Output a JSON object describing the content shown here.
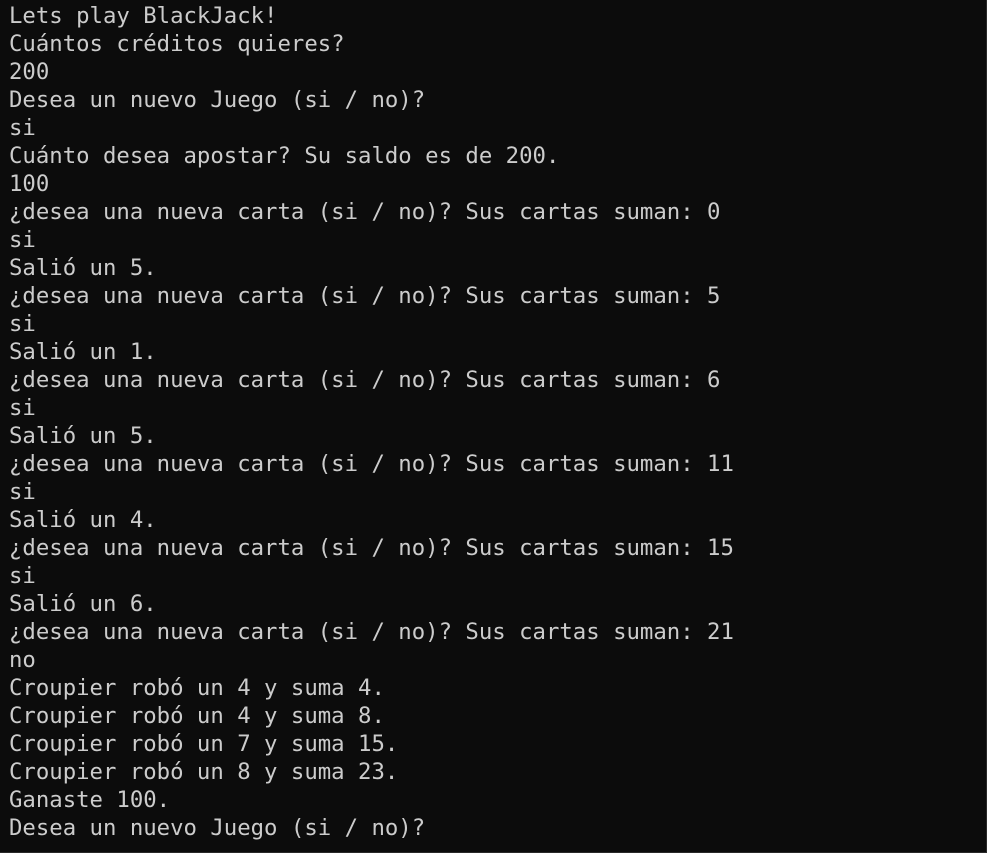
{
  "terminal": {
    "colors": {
      "background": "#0c0c0c",
      "foreground": "#cccccc"
    },
    "lines": [
      "Lets play BlackJack!",
      "Cuántos créditos quieres?",
      "200",
      "Desea un nuevo Juego (si / no)?",
      "si",
      "Cuánto desea apostar? Su saldo es de 200.",
      "100",
      "¿desea una nueva carta (si / no)? Sus cartas suman: 0",
      "si",
      "Salió un 5.",
      "¿desea una nueva carta (si / no)? Sus cartas suman: 5",
      "si",
      "Salió un 1.",
      "¿desea una nueva carta (si / no)? Sus cartas suman: 6",
      "si",
      "Salió un 5.",
      "¿desea una nueva carta (si / no)? Sus cartas suman: 11",
      "si",
      "Salió un 4.",
      "¿desea una nueva carta (si / no)? Sus cartas suman: 15",
      "si",
      "Salió un 6.",
      "¿desea una nueva carta (si / no)? Sus cartas suman: 21",
      "no",
      "Croupier robó un 4 y suma 4.",
      "Croupier robó un 4 y suma 8.",
      "Croupier robó un 7 y suma 15.",
      "Croupier robó un 8 y suma 23.",
      "Ganaste 100.",
      "Desea un nuevo Juego (si / no)?"
    ]
  }
}
